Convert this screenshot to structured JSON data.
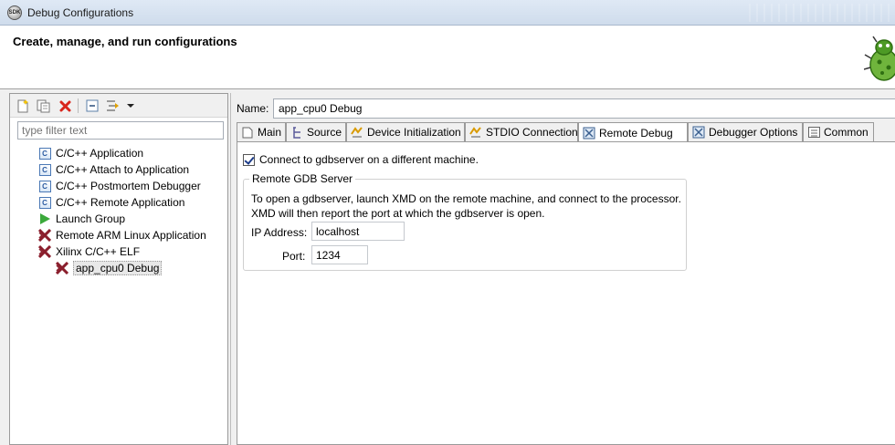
{
  "window": {
    "title": "Debug Configurations",
    "app_icon_text": "SDK"
  },
  "header": {
    "title": "Create, manage, and run configurations"
  },
  "filter": {
    "placeholder": "type filter text"
  },
  "toolbar": {
    "icons": [
      "new-configuration-icon",
      "duplicate-icon",
      "delete-icon",
      "collapse-all-icon",
      "filter-icon",
      "dropdown-arrow-icon"
    ],
    "colors": {
      "delete": "#d9261c"
    }
  },
  "tree": {
    "items": [
      {
        "label": "C/C++ Application",
        "icon": "c-app-icon",
        "level": 1
      },
      {
        "label": "C/C++ Attach to Application",
        "icon": "c-app-icon",
        "level": 1
      },
      {
        "label": "C/C++ Postmortem Debugger",
        "icon": "c-app-icon",
        "level": 1
      },
      {
        "label": "C/C++ Remote Application",
        "icon": "c-app-icon",
        "level": 1
      },
      {
        "label": "Launch Group",
        "icon": "launch-group-icon",
        "level": 1
      },
      {
        "label": "Remote ARM Linux Application",
        "icon": "xilinx-icon",
        "level": 1
      },
      {
        "label": "Xilinx C/C++ ELF",
        "icon": "xilinx-icon",
        "level": 1
      },
      {
        "label": "app_cpu0 Debug",
        "icon": "xilinx-icon",
        "level": 2,
        "selected": true
      }
    ]
  },
  "config": {
    "name_label": "Name:",
    "name_value": "app_cpu0 Debug",
    "tabs": [
      {
        "label": "Main",
        "icon": "main-tab-icon"
      },
      {
        "label": "Source",
        "icon": "source-tab-icon"
      },
      {
        "label": "Device Initialization",
        "icon": "device-init-icon"
      },
      {
        "label": "STDIO Connection",
        "icon": "stdio-icon"
      },
      {
        "label": "Remote Debug",
        "icon": "remote-debug-icon",
        "active": true
      },
      {
        "label": "Debugger Options",
        "icon": "debugger-options-icon"
      },
      {
        "label": "Common",
        "icon": "common-tab-icon"
      }
    ],
    "remote": {
      "checkbox_label": "Connect to gdbserver on a different machine.",
      "checked": true,
      "group_title": "Remote GDB Server",
      "description_line1": "To open a gdbserver, launch XMD on the remote machine, and connect to the processor.",
      "description_line2": "XMD will then report the port at which the gdbserver is open.",
      "ip_label": "IP Address:",
      "ip_value": "localhost",
      "port_label": "Port:",
      "port_value": "1234"
    }
  }
}
